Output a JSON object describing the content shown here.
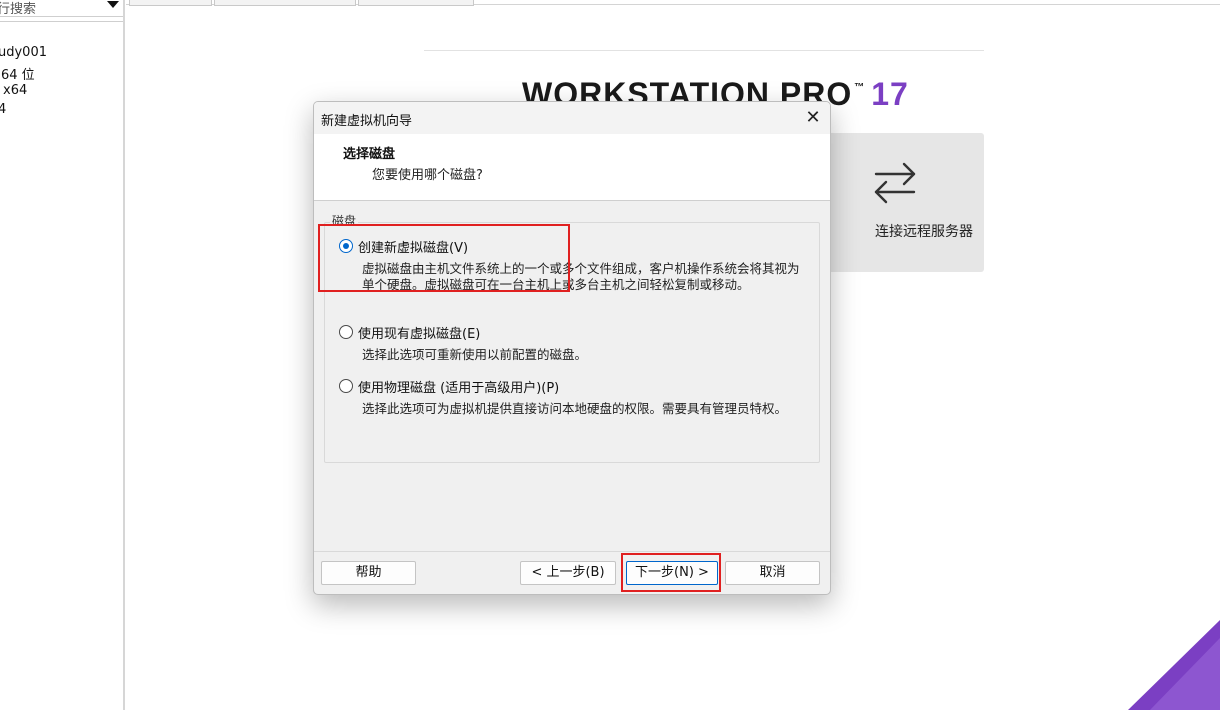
{
  "library": {
    "search_placeholder": "行搜索",
    "lines": [
      "udy001",
      "64 位",
      "x64",
      "4"
    ]
  },
  "home": {
    "brand_name": "WORKSTATION PRO",
    "brand_tm": "™",
    "brand_version": "17",
    "remote_server_label": "连接远程服务器"
  },
  "dialog": {
    "title": "新建虚拟机向导",
    "close_glyph": "✕",
    "header_title": "选择磁盘",
    "header_subtitle": "您要使用哪个磁盘?",
    "group_label": "磁盘",
    "options": [
      {
        "label": "创建新虚拟磁盘(V)",
        "desc": "虚拟磁盘由主机文件系统上的一个或多个文件组成，客户机操作系统会将其视为单个硬盘。虚拟磁盘可在一台主机上或多台主机之间轻松复制或移动。",
        "selected": true
      },
      {
        "label": "使用现有虚拟磁盘(E)",
        "desc": "选择此选项可重新使用以前配置的磁盘。",
        "selected": false
      },
      {
        "label": "使用物理磁盘 (适用于高级用户)(P)",
        "desc": "选择此选项可为虚拟机提供直接访问本地硬盘的权限。需要具有管理员特权。",
        "selected": false
      }
    ],
    "buttons": {
      "help": "帮助",
      "back": "< 上一步(B)",
      "next": "下一步(N) >",
      "cancel": "取消"
    }
  },
  "colors": {
    "accent": "#0066cc",
    "brand_purple": "#7b3fc3",
    "highlight_red": "#e02020"
  },
  "icons": {
    "remote": "swap-arrows-icon",
    "close": "close-icon",
    "dropdown": "chevron-down-icon"
  }
}
